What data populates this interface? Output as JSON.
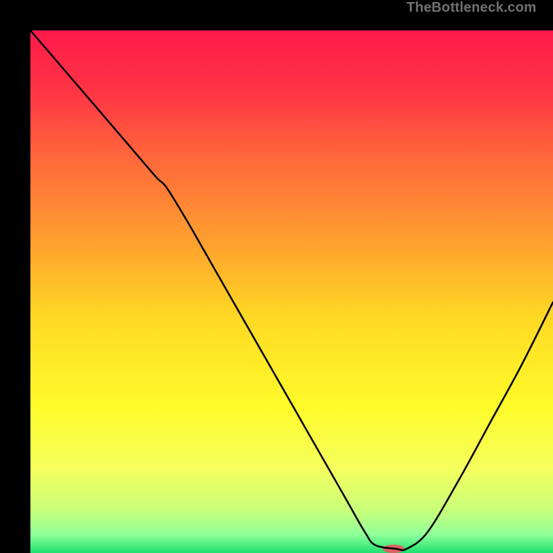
{
  "watermark": "TheBottleneck.com",
  "chart_data": {
    "type": "line",
    "title": "",
    "xlabel": "",
    "ylabel": "",
    "xlim": [
      0,
      100
    ],
    "ylim": [
      0,
      100
    ],
    "grid": false,
    "legend": false,
    "background_gradient": {
      "stops": [
        {
          "pos": 0.0,
          "color": "#ff1a4b"
        },
        {
          "pos": 0.12,
          "color": "#ff3545"
        },
        {
          "pos": 0.25,
          "color": "#ff6a3a"
        },
        {
          "pos": 0.4,
          "color": "#ff9e2f"
        },
        {
          "pos": 0.55,
          "color": "#ffd923"
        },
        {
          "pos": 0.72,
          "color": "#fffb2a"
        },
        {
          "pos": 0.84,
          "color": "#f5ff5e"
        },
        {
          "pos": 0.92,
          "color": "#c7ff7a"
        },
        {
          "pos": 0.965,
          "color": "#8fff9a"
        },
        {
          "pos": 1.0,
          "color": "#1ee06f"
        }
      ]
    },
    "series": [
      {
        "name": "bottleneck-curve",
        "color": "#000000",
        "width": 2.6,
        "x": [
          0,
          6,
          12,
          18,
          24,
          26,
          30,
          36,
          42,
          48,
          54,
          60,
          64,
          66,
          70,
          72,
          76,
          82,
          88,
          94,
          100
        ],
        "y": [
          100,
          93,
          86,
          79,
          72,
          70,
          63.5,
          53,
          42.5,
          32,
          21.5,
          11,
          4,
          1.5,
          0.8,
          0.8,
          4,
          14,
          25,
          36,
          48
        ]
      }
    ],
    "marker": {
      "name": "optimal-marker",
      "x": 69.5,
      "y": 0.8,
      "color": "#e06060",
      "rx": 16,
      "ry": 6
    }
  }
}
